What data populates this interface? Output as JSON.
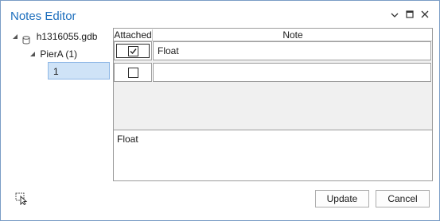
{
  "window": {
    "title": "Notes Editor"
  },
  "titlebar": {
    "dropdown_icon": "chevron-down-icon",
    "restore_icon": "restore-icon",
    "close_icon": "close-icon"
  },
  "tree": {
    "root": {
      "label": "h1316055.gdb",
      "icon": "database-icon",
      "expanded": true
    },
    "child": {
      "label": "PierA (1)",
      "expanded": true
    },
    "item": {
      "label": "1",
      "selected": true
    }
  },
  "grid": {
    "columns": [
      "Attached",
      "Note"
    ],
    "rows": [
      {
        "attached": true,
        "note": "Float"
      },
      {
        "attached": false,
        "note": ""
      }
    ]
  },
  "note_text": "Float",
  "buttons": {
    "update": "Update",
    "cancel": "Cancel"
  },
  "footer": {
    "icon": "pick-feature-icon"
  }
}
